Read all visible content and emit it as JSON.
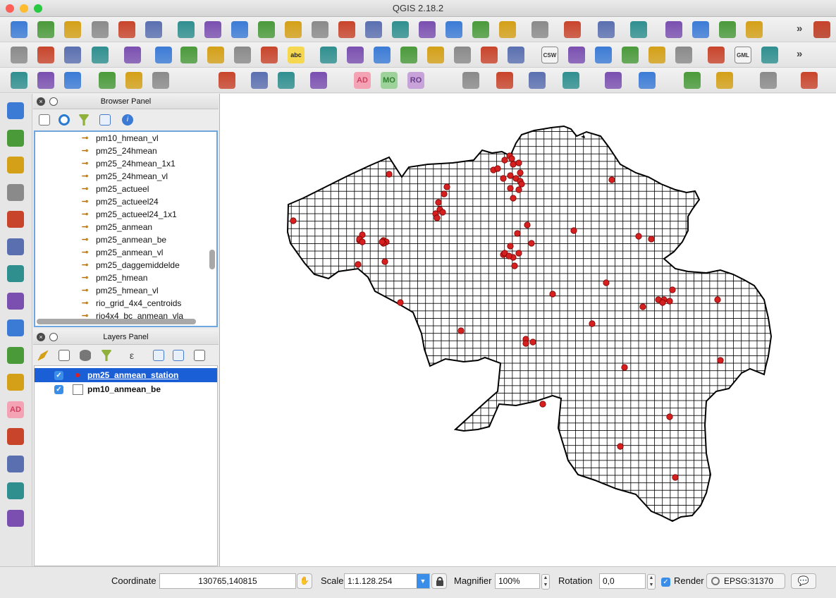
{
  "window": {
    "title": "QGIS 2.18.2"
  },
  "toolbar_rows": [
    {
      "icons": [
        "new-project",
        "open-project",
        "save-project",
        "save-as",
        "new-print-composer",
        "composer-manager",
        "pan-map",
        "pan-to-selection",
        "zoom-in",
        "zoom-out",
        "zoom-native",
        "zoom-full",
        "zoom-to-selection",
        "zoom-to-layer",
        "zoom-last",
        "zoom-next",
        "new-map-view",
        "new-bookmark",
        "show-bookmarks",
        "refresh",
        "identify",
        "run-action",
        "select-features",
        "expression-select",
        "deselect-all",
        "attribute-table",
        "field-calculator",
        "statistics",
        "help"
      ]
    },
    {
      "icons": [
        "current-edits",
        "toggle-editing",
        "save-edits",
        "add-feature",
        "move-feature",
        "node-tool",
        "delete-selected",
        "cut-features",
        "copy-features",
        "paste-features",
        "label-tool",
        "diagram-tool",
        "highlight-pinned-labels",
        "pin-labels",
        "show-hide-labels",
        "move-label",
        "rotate-label",
        "change-label",
        "coordinate-capture",
        "csw",
        "metasearch",
        "wms-search",
        "qms-search",
        "plugin",
        "python-console",
        "print",
        "gml",
        "db-manager"
      ]
    },
    {
      "icons": [
        "add-layer-1",
        "add-layer-2",
        "add-layer-3",
        "add-point",
        "add-vertex",
        "digitize",
        "numerical-digitize",
        "gps-tool",
        "settings-tool",
        "qgis-cloud",
        "ad-tool",
        "mo-tool",
        "ro-tool",
        "measure",
        "mouse-tool",
        "processing",
        "geocode",
        "google-earth",
        "home",
        "scale-tool",
        "db-tool",
        "lightning",
        "layer-tree"
      ]
    }
  ],
  "toolbar_labels": {
    "ad": "AD",
    "mo": "MO",
    "ro": "RO",
    "csw": "CSW",
    "gml": "GML",
    "abc": "abc"
  },
  "browser_panel": {
    "title": "Browser Panel",
    "items": [
      "pm10_hmean_vl",
      "pm25_24hmean",
      "pm25_24hmean_1x1",
      "pm25_24hmean_vl",
      "pm25_actueel",
      "pm25_actueel24",
      "pm25_actueel24_1x1",
      "pm25_anmean",
      "pm25_anmean_be",
      "pm25_anmean_vl",
      "pm25_daggemiddelde",
      "pm25_hmean",
      "pm25_hmean_vl",
      "rio_grid_4x4_centroids",
      "rio4x4_bc_anmean_vla"
    ]
  },
  "layers_panel": {
    "title": "Layers Panel",
    "layers": [
      {
        "name": "pm25_anmean_station",
        "checked": true,
        "selected": true
      },
      {
        "name": "pm10_anmean_be",
        "checked": true,
        "selected": false
      }
    ]
  },
  "statusbar": {
    "coordinate_label": "Coordinate",
    "coordinate_value": "130765,140815",
    "scale_label": "Scale",
    "scale_value": "1:1.128.254",
    "magnifier_label": "Magnifier",
    "magnifier_value": "100%",
    "rotation_label": "Rotation",
    "rotation_value": "0,0",
    "render_label": "Render",
    "render_checked": true,
    "crs": "EPSG:31370"
  },
  "map": {
    "station_color": "#d62020",
    "grid_color": "#000000",
    "station_count": 70
  },
  "colors": {
    "selection": "#1b5fd6",
    "checkbox": "#3b8ee8",
    "panel_focus": "#6fa6e0"
  }
}
